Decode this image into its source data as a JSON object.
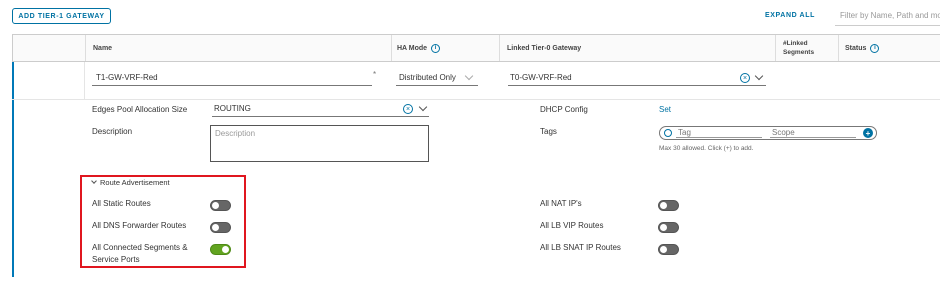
{
  "toolbar": {
    "add_button_label": "ADD TIER-1 GATEWAY",
    "expand_all_label": "EXPAND ALL",
    "filter_placeholder": "Filter by Name, Path and more"
  },
  "table": {
    "headers": {
      "name": "Name",
      "ha_mode": "HA Mode",
      "linked_tier0": "Linked Tier-0 Gateway",
      "linked_segments": "#Linked\nSegments",
      "status": "Status"
    }
  },
  "row": {
    "name_value": "T1-GW-VRF-Red",
    "required_marker": "*",
    "ha_mode_value": "Distributed Only",
    "linked_tier0_value": "T0-GW-VRF-Red"
  },
  "details": {
    "edges_pool_label": "Edges Pool Allocation Size",
    "edges_pool_value": "ROUTING",
    "description_label": "Description",
    "description_placeholder": "Description",
    "dhcp_label": "DHCP Config",
    "dhcp_link": "Set",
    "tags_label": "Tags",
    "tag_placeholder": "Tag",
    "scope_placeholder": "Scope",
    "tags_hint": "Max 30 allowed. Click (+) to add."
  },
  "route_advertisement": {
    "section_label": "Route Advertisement",
    "left": [
      {
        "label": "All Static Routes",
        "on": false
      },
      {
        "label": "All DNS Forwarder Routes",
        "on": false
      },
      {
        "label": "All Connected Segments &\nService Ports",
        "on": true
      }
    ],
    "right": [
      {
        "label": "All NAT IP's",
        "on": false
      },
      {
        "label": "All LB VIP Routes",
        "on": false
      },
      {
        "label": "All LB SNAT IP Routes",
        "on": false
      }
    ]
  },
  "colors": {
    "accent": "#0072a3",
    "toggle_on": "#62a420",
    "toggle_off": "#666666",
    "highlight": "#e0161f"
  }
}
